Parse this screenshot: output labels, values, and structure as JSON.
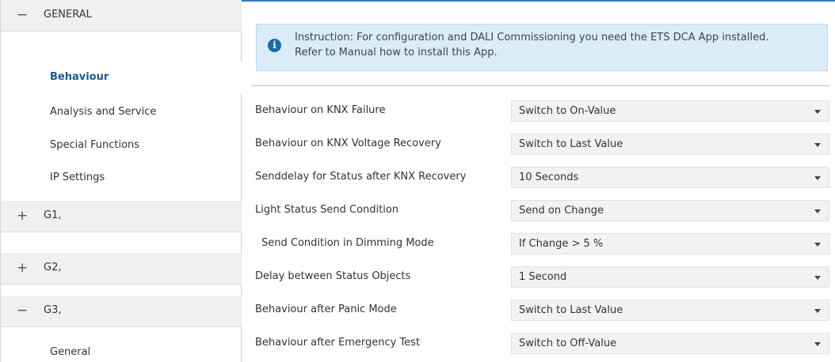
{
  "sidebar": {
    "general_symbol": "−",
    "general_label": "GENERAL",
    "general_items": [
      "Behaviour",
      "Analysis and Service",
      "Special Functions",
      "IP Settings"
    ],
    "g1_symbol": "+",
    "g1_label": "G1,",
    "g2_symbol": "+",
    "g2_label": "G2,",
    "g3_symbol": "−",
    "g3_label": "G3,",
    "g3_items": [
      "General"
    ]
  },
  "info": {
    "icon": "i",
    "line1": "Instruction: For configuration and DALI Commissioning you need the ETS DCA App installed.",
    "line2": "Refer to Manual how to install this App."
  },
  "rows": [
    {
      "label": "Behaviour on KNX Failure",
      "value": "Switch to On-Value",
      "indent": false
    },
    {
      "label": "Behaviour on KNX Voltage Recovery",
      "value": "Switch to Last Value",
      "indent": false
    },
    {
      "label": "Senddelay for Status after KNX Recovery",
      "value": "10 Seconds",
      "indent": false
    },
    {
      "label": "Light Status Send Condition",
      "value": "Send on Change",
      "indent": false
    },
    {
      "label": "Send Condition in Dimming Mode",
      "value": "If Change > 5 %",
      "indent": true
    },
    {
      "label": "Delay between Status Objects",
      "value": "1 Second",
      "indent": false
    },
    {
      "label": "Behaviour after Panic Mode",
      "value": "Switch to Last Value",
      "indent": false
    },
    {
      "label": "Behaviour after Emergency Test",
      "value": "Switch to Off-Value",
      "indent": false
    }
  ],
  "colors": {
    "accent": "#3a78c2",
    "active_item": "#1f5a8c",
    "info_background": "#d9ecf7",
    "info_icon": "#1a6ea8"
  }
}
